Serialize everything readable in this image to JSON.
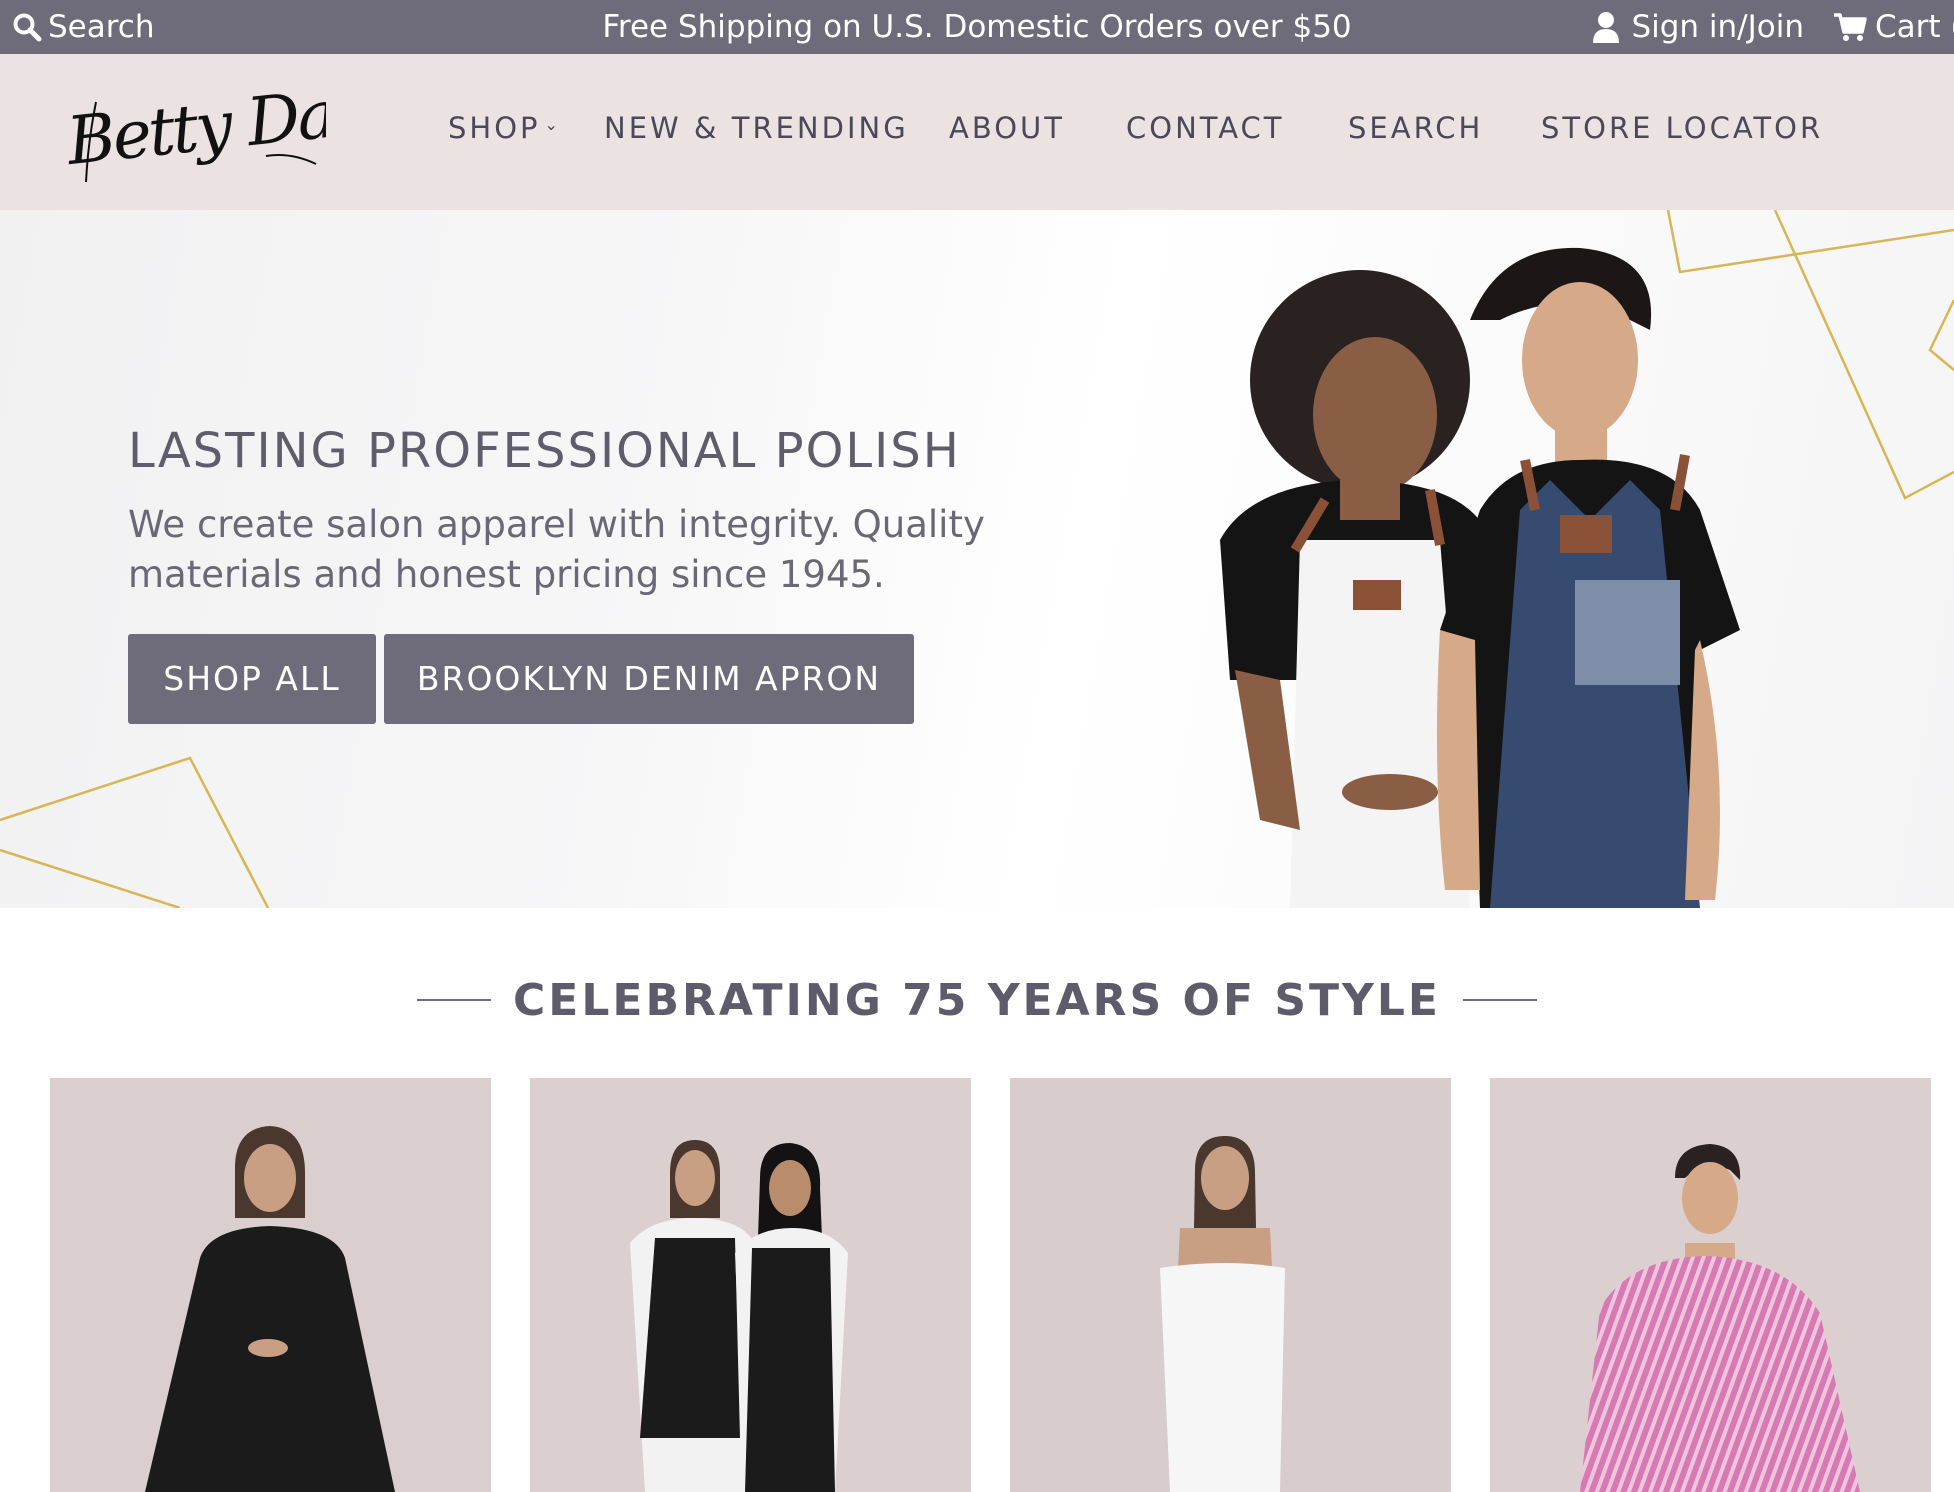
{
  "topbar": {
    "search_label": "Search",
    "promo": "Free Shipping on U.S. Domestic Orders over $50",
    "account_label": "Sign in/Join",
    "cart_label": "Cart ("
  },
  "header": {
    "logo_text": "Betty Dain",
    "nav": [
      {
        "label": "SHOP",
        "has_dropdown": true
      },
      {
        "label": "NEW & TRENDING"
      },
      {
        "label": "ABOUT"
      },
      {
        "label": "CONTACT"
      },
      {
        "label": "SEARCH"
      },
      {
        "label": "STORE LOCATOR"
      }
    ]
  },
  "hero": {
    "title": "LASTING PROFESSIONAL POLISH",
    "subtitle": "We create salon apparel with integrity. Quality materials and honest pricing since 1945.",
    "buttons": [
      {
        "label": "SHOP ALL"
      },
      {
        "label": "BROOKLYN DENIM APRON"
      }
    ]
  },
  "section": {
    "title": "CELEBRATING 75 YEARS OF STYLE"
  },
  "products": [
    {
      "image": "woman-black-cape"
    },
    {
      "image": "two-women-black-vests"
    },
    {
      "image": "woman-white-wrap"
    },
    {
      "image": "man-pink-striped-cape"
    }
  ],
  "colors": {
    "topbar_bg": "#6e6c7a",
    "header_bg": "#ebe3e2",
    "nav_text": "#4a4859",
    "button_bg": "#6e6c7a",
    "gold_accent": "#d4b24c",
    "card_bg": "#dccfcf"
  }
}
